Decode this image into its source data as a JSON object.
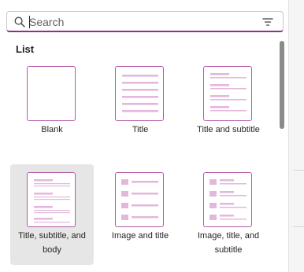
{
  "search": {
    "value": "",
    "placeholder": "Search"
  },
  "section": {
    "title": "List"
  },
  "colors": {
    "accent": "#8f2f8c",
    "thumb_border": "#b45aa8",
    "thumb_line": "#e3b7dc",
    "selected_bg": "#e6e6e6"
  },
  "icons": {
    "search": "search-icon",
    "filter": "filter-icon",
    "image": "image-icon"
  },
  "templates": [
    {
      "label": "Blank",
      "selected": false
    },
    {
      "label": "Title",
      "selected": false
    },
    {
      "label": "Title and subtitle",
      "selected": false
    },
    {
      "label": "Title, subtitle, and body",
      "selected": true
    },
    {
      "label": "Image and title",
      "selected": false
    },
    {
      "label": "Image, title, and subtitle",
      "selected": false
    }
  ]
}
